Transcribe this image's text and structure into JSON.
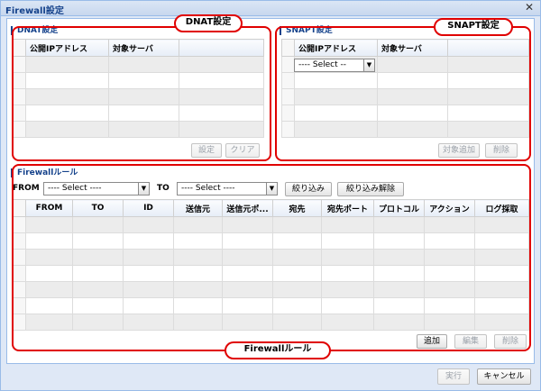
{
  "window": {
    "title": "Firewall設定"
  },
  "dnat": {
    "legend": "DNAT設定",
    "columns": [
      "公開IPアドレス",
      "対象サーバ"
    ],
    "buttons": {
      "set": "設定",
      "clear": "クリア"
    },
    "callout": "DNAT設定"
  },
  "snapt": {
    "legend": "SNAPT設定",
    "columns": [
      "公開IPアドレス",
      "対象サーバ"
    ],
    "combo_value": "---- Select --",
    "buttons": {
      "add_target": "対象追加",
      "delete": "削除"
    },
    "callout": "SNAPT設定"
  },
  "firewall": {
    "legend": "Firewallルール",
    "from_label": "FROM",
    "to_label": "TO",
    "from_select": "---- Select ----",
    "to_select": "---- Select ----",
    "filter_button": "絞り込み",
    "clear_filter_button": "絞り込み解除",
    "columns": [
      "FROM",
      "TO",
      "ID",
      "送信元",
      "送信元ポ...",
      "宛先",
      "宛先ポート",
      "プロトコル",
      "アクション",
      "ログ採取"
    ],
    "buttons": {
      "add": "追加",
      "edit": "編集",
      "delete": "削除"
    },
    "callout": "Firewallルール"
  },
  "footer": {
    "execute": "実行",
    "cancel": "キャンセル"
  },
  "colors": {
    "highlight": "#e00000",
    "title_text": "#15428b",
    "window_bg": "#dfe8f6"
  }
}
